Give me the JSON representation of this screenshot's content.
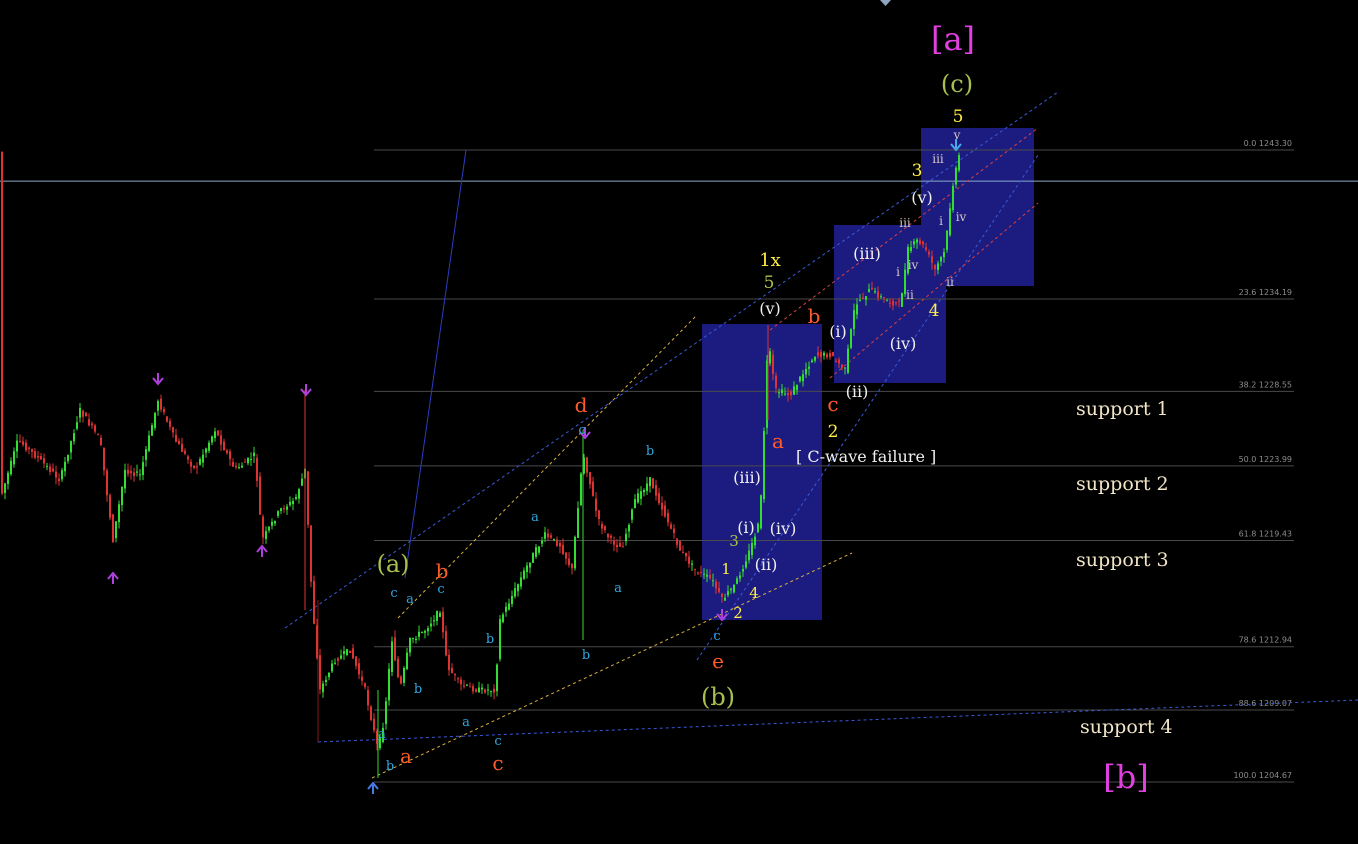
{
  "chart_data": {
    "type": "candlestick",
    "colors": {
      "background": "#000000",
      "bull_candle": "#33dd33",
      "bear_candle": "#dd3333",
      "projection_box": "#1c1c80",
      "fib_line": "#4a4a4a",
      "current_price_line": "#8aa9c8",
      "primary_label": "#e040e0",
      "intermediate_label": "#a8c050",
      "minor_label": "#ffee44",
      "minute_label": "#f0f0f0",
      "sub_label_red": "#ff5a2a",
      "sub_label_blue": "#2fa8e0",
      "arrow_purple": "#b040e0"
    },
    "fib_levels": [
      {
        "ratio": "0.0",
        "price": 1243.3,
        "label": "0.0 1243.30"
      },
      {
        "ratio": "23.6",
        "price": 1234.19,
        "label": "23.6 1234.19"
      },
      {
        "ratio": "38.2",
        "price": 1228.55,
        "label": "38.2 1228.55"
      },
      {
        "ratio": "50.0",
        "price": 1223.99,
        "label": "50.0 1223.99"
      },
      {
        "ratio": "61.8",
        "price": 1219.43,
        "label": "61.8 1219.43"
      },
      {
        "ratio": "78.6",
        "price": 1212.94,
        "label": "78.6 1212.94"
      },
      {
        "ratio": "88.6",
        "price": 1209.07,
        "label": "88.6 1209.07"
      },
      {
        "ratio": "100.0",
        "price": 1204.67,
        "label": "100.0 1204.67"
      }
    ],
    "current_price": 1241.4,
    "support_levels": [
      {
        "text": "support 1",
        "price": 1228.5
      },
      {
        "text": "support 2",
        "price": 1223.9
      },
      {
        "text": "support 3",
        "price": 1219.4
      },
      {
        "text": "support 4",
        "price": 1209.0
      }
    ],
    "annotation_text": "[ C-wave failure ]",
    "wave_labels": {
      "primary": [
        "[a]",
        "[b]"
      ],
      "intermediate": [
        "(a)",
        "(b)",
        "(c)"
      ],
      "minor": [
        "1x",
        "5",
        "3",
        "2",
        "4",
        "1"
      ],
      "minute": [
        "(i)",
        "(ii)",
        "(iii)",
        "(iv)",
        "(v)"
      ],
      "subminuette": [
        "i",
        "ii",
        "iii",
        "iv",
        "v"
      ],
      "corrective": [
        "a",
        "b",
        "c",
        "d",
        "e"
      ]
    }
  }
}
